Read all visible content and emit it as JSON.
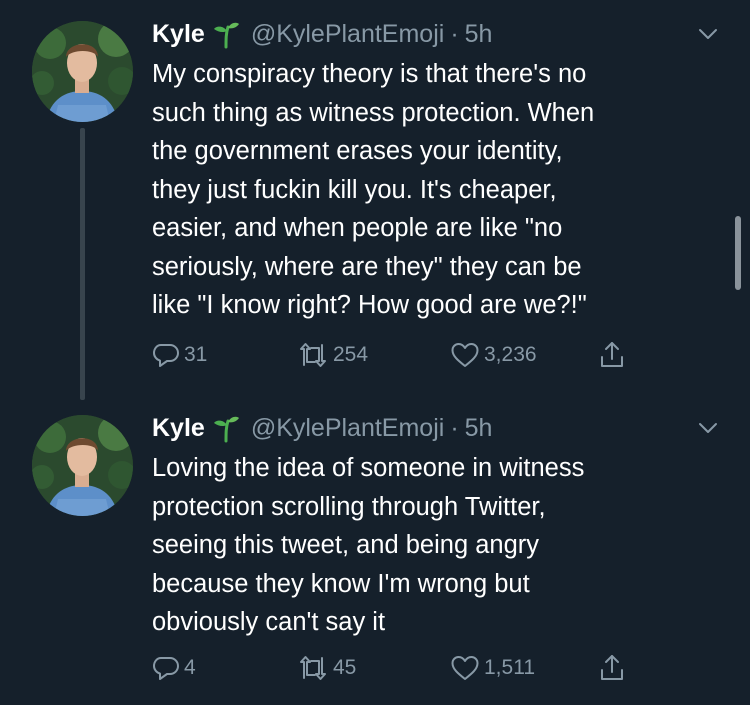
{
  "colors": {
    "background": "#15202b",
    "text": "#ffffff",
    "muted": "#8899a6",
    "thread_line": "#38444d",
    "sprout": "#4caf50"
  },
  "tweets": [
    {
      "name": "Kyle",
      "name_emoji": "sprout-icon",
      "handle": "@KylePlantEmoji",
      "separator": "·",
      "time": "5h",
      "text": "My conspiracy theory is that there's no\nsuch thing as witness protection. When\nthe government erases your identity,\nthey just fuckin kill you. It's cheaper,\neasier, and when people are like \"no\nseriously, where are they\" they can be\nlike \"I know right? How good are we?!\"",
      "replies": "31",
      "retweets": "254",
      "likes": "3,236"
    },
    {
      "name": "Kyle",
      "name_emoji": "sprout-icon",
      "handle": "@KylePlantEmoji",
      "separator": "·",
      "time": "5h",
      "text": "Loving the idea of someone in witness\nprotection scrolling through Twitter,\nseeing this tweet, and being angry\nbecause they know I'm wrong but\nobviously can't say it",
      "replies": "4",
      "retweets": "45",
      "likes": "1,511"
    }
  ]
}
